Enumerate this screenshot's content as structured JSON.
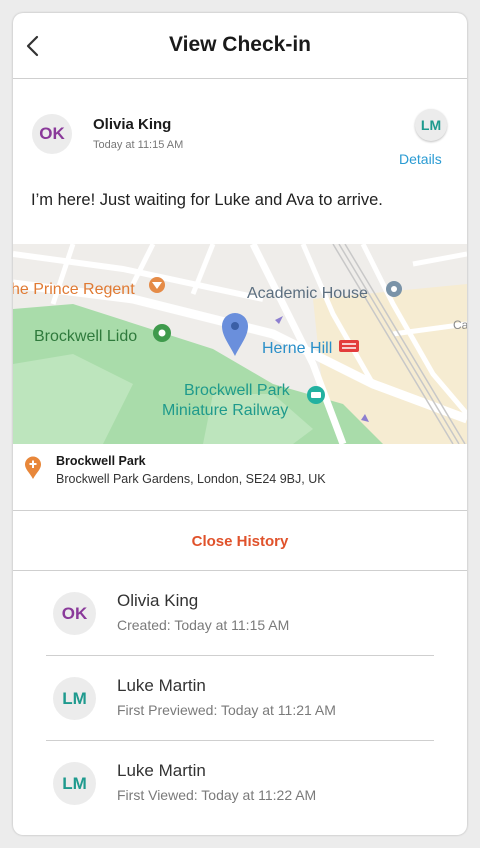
{
  "header": {
    "title": "View Check-in",
    "back_icon": "chevron-left-icon"
  },
  "author": {
    "initials": "OK",
    "name": "Olivia King",
    "time": "Today at 11:15 AM",
    "recipient_initials": "LM",
    "details_label": "Details"
  },
  "message": "I’m here! Just waiting for Luke and Ava to arrive.",
  "map": {
    "labels": {
      "prince_regent": "he Prince Regent",
      "academic_house": "Academic House",
      "brockwell_lido": "Brockwell Lido",
      "herne_hill": "Herne Hill",
      "park_railway_line1": "Brockwell Park",
      "park_railway_line2": "Miniature Railway",
      "ca": "Ca"
    }
  },
  "location": {
    "name": "Brockwell Park",
    "address": "Brockwell Park Gardens, London, SE24 9BJ, UK"
  },
  "close_history_label": "Close History",
  "history": [
    {
      "initials": "OK",
      "name": "Olivia King",
      "detail": "Created: Today at 11:15 AM"
    },
    {
      "initials": "LM",
      "name": "Luke Martin",
      "detail": "First Previewed: Today at 11:21 AM"
    },
    {
      "initials": "LM",
      "name": "Luke Martin",
      "detail": "First Viewed: Today at 11:22 AM"
    }
  ],
  "colors": {
    "accent_orange": "#e0522b",
    "link_blue": "#2a9bd3",
    "ok_purple": "#8a3a9a",
    "lm_teal": "#1e9a8e",
    "park_green": "#a8dba8"
  }
}
